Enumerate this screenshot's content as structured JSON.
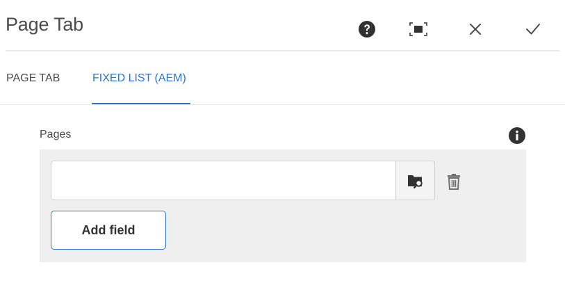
{
  "dialog": {
    "title": "Page Tab",
    "actions": {
      "help_icon": "question-circle-icon",
      "fullscreen_icon": "fullscreen-icon",
      "close_icon": "close-icon",
      "done_icon": "checkmark-icon"
    }
  },
  "tabs": [
    {
      "label": "PAGE TAB",
      "active": false
    },
    {
      "label": "FIXED LIST (AEM)",
      "active": true
    }
  ],
  "pages_field": {
    "label": "Pages",
    "info_icon": "info-circle-icon",
    "items": [
      {
        "value": "",
        "browse_icon": "folder-search-icon",
        "delete_icon": "trash-icon"
      }
    ],
    "add_label": "Add field"
  },
  "colors": {
    "accent": "#2b74c9",
    "text": "#4b4b4b",
    "panel_bg": "#efefef",
    "rule": "#e9e9e9"
  }
}
